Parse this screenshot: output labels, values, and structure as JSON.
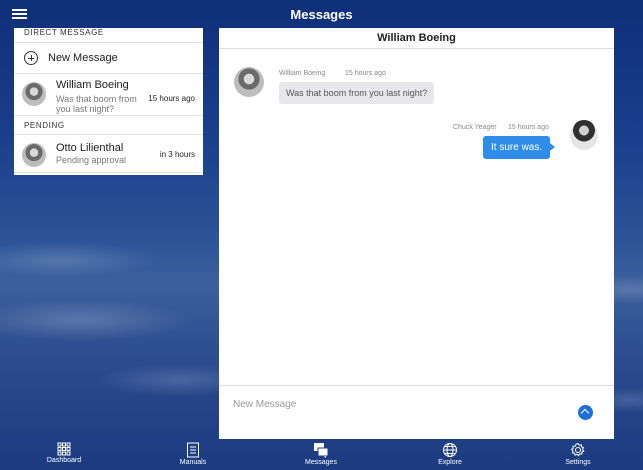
{
  "header": {
    "title": "Messages"
  },
  "sidebar": {
    "direct_header": "DIRECT MESSAGE",
    "new_message_label": "New Message",
    "conversations": [
      {
        "name": "William Boeing",
        "preview": "Was that boom from you last night?",
        "time": "15 hours ago"
      }
    ],
    "pending_header": "PENDING",
    "pending": [
      {
        "name": "Otto Lilienthal",
        "preview": "Pending approval",
        "time": "in 3 hours"
      }
    ]
  },
  "chat": {
    "title": "William Boeing",
    "messages": [
      {
        "sender": "William Boeing",
        "time": "15 hours ago",
        "text": "Was that boom from you last night?"
      },
      {
        "sender": "Chuck Yeager",
        "time": "15 hours ago",
        "text": "It sure was."
      }
    ],
    "composer_placeholder": "New Message"
  },
  "tabs": [
    {
      "label": "Dashboard",
      "icon": "grid-icon"
    },
    {
      "label": "Manuals",
      "icon": "book-icon"
    },
    {
      "label": "Messages",
      "icon": "chat-bubbles-icon"
    },
    {
      "label": "Explore",
      "icon": "globe-icon"
    },
    {
      "label": "Settings",
      "icon": "gear-icon"
    }
  ],
  "colors": {
    "accent": "#2f8ce8",
    "send": "#1e6fdc"
  }
}
